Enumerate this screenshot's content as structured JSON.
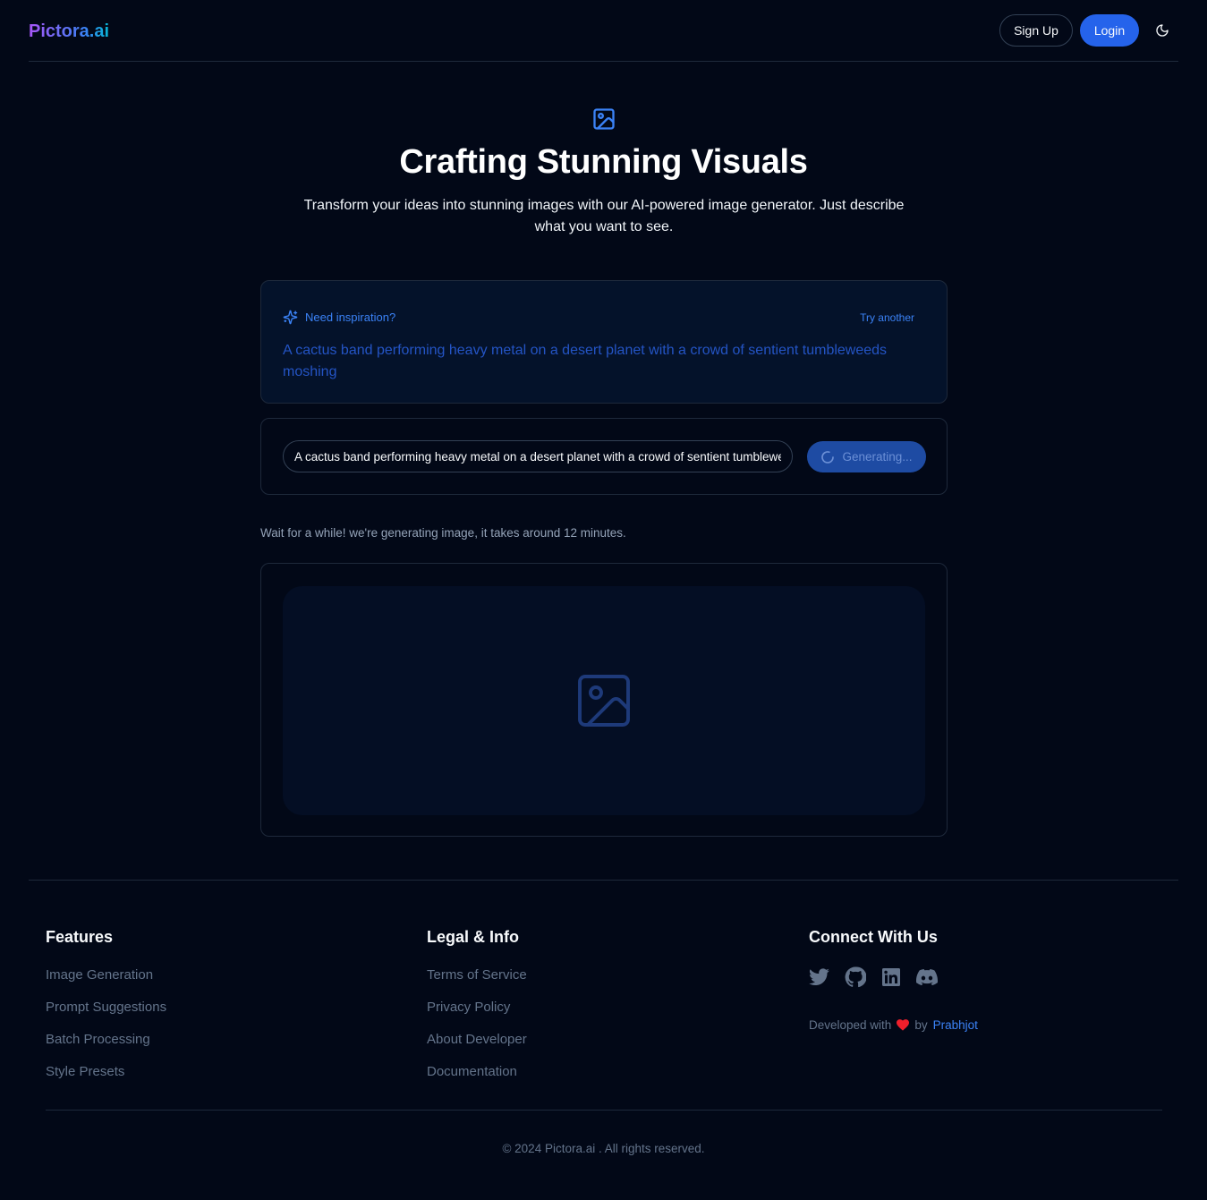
{
  "header": {
    "logo": "Pictora.ai",
    "signup_label": "Sign Up",
    "login_label": "Login",
    "theme_icon": "moon-icon"
  },
  "hero": {
    "icon": "image-icon",
    "title": "Crafting Stunning Visuals",
    "subtitle": "Transform your ideas into stunning images with our AI-powered image generator. Just describe what you want to see."
  },
  "inspiration": {
    "icon": "sparkles-icon",
    "label": "Need inspiration?",
    "try_label": "Try another",
    "text": "A cactus band performing heavy metal on a desert planet with a crowd of sentient tumbleweeds moshing"
  },
  "prompt": {
    "value": "A cactus band performing heavy metal on a desert planet with a crowd of sentient tumbleweeds moshing",
    "button_label": "Generating..."
  },
  "status": {
    "wait_text": "Wait for a while! we're generating image, it takes around 12 minutes."
  },
  "footer": {
    "features": {
      "heading": "Features",
      "links": [
        "Image Generation",
        "Prompt Suggestions",
        "Batch Processing",
        "Style Presets"
      ]
    },
    "legal": {
      "heading": "Legal & Info",
      "links": [
        "Terms of Service",
        "Privacy Policy",
        "About Developer",
        "Documentation"
      ]
    },
    "connect": {
      "heading": "Connect With Us",
      "social_icons": [
        "twitter-icon",
        "github-icon",
        "linkedin-icon",
        "discord-icon"
      ],
      "developed_prefix": "Developed with",
      "developed_by": "by",
      "developer_name": "Prabhjot"
    },
    "copyright": "© 2024 Pictora.ai . All rights reserved."
  },
  "colors": {
    "background": "#020817",
    "accent": "#2563eb",
    "link": "#3b82f6",
    "border": "#1e293b"
  }
}
